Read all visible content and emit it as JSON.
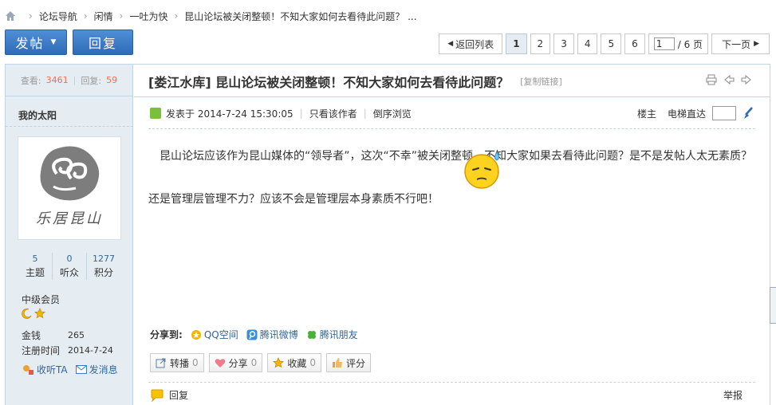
{
  "breadcrumb": {
    "items": [
      "论坛导航",
      "闲情",
      "一吐为快",
      "昆山论坛被关闭整顿！不知大家如何去看待此问题？ ..."
    ],
    "separator": "›"
  },
  "actions": {
    "post": "发帖",
    "reply": "回复"
  },
  "pager": {
    "back": "返回列表",
    "pages": [
      "1",
      "2",
      "3",
      "4",
      "5",
      "6"
    ],
    "current": "1",
    "jump_value": "1",
    "jump_total": "/ 6 页",
    "next": "下一页"
  },
  "sidebar": {
    "views_label": "查看:",
    "views": "3461",
    "sep": "|",
    "replies_label": "回复:",
    "replies": "59",
    "username": "我的太阳",
    "avatar_text": "乐居昆山",
    "counts": [
      {
        "value": "5",
        "label": "主题"
      },
      {
        "value": "0",
        "label": "听众"
      },
      {
        "value": "1277",
        "label": "积分"
      }
    ],
    "group": "中级会员",
    "info": [
      {
        "key": "金钱",
        "value": "265"
      },
      {
        "key": "注册时间",
        "value": "2014-7-24"
      }
    ],
    "follow": "收听TA",
    "message": "发消息"
  },
  "post": {
    "title": "[娄江水库] 昆山论坛被关闭整顿！不知大家如何去看待此问题？",
    "copy_link": "[复制链接]",
    "posted": "发表于 2014-7-24 15:30:05",
    "only_author": "只看该作者",
    "reverse": "倒序浏览",
    "floor": "楼主",
    "elevator": "电梯直达",
    "content": "昆山论坛应该作为昆山媒体的“领导者”，这次“不幸”被关闭整顿，不知大家如果去看待此问题？是不是发帖人太无素质？还是管理层管理不力？应该不会是管理层本身素质不行吧！",
    "share_label": "分享到:",
    "share_items": [
      "QQ空间",
      "腾讯微博",
      "腾讯朋友"
    ],
    "buttons": [
      {
        "label": "转播",
        "count": "0"
      },
      {
        "label": "分享",
        "count": "0"
      },
      {
        "label": "收藏",
        "count": "0"
      },
      {
        "label": "评分",
        "count": ""
      }
    ],
    "reply": "回复",
    "report": "举报"
  },
  "colors": {
    "accent": "#2f6bb8",
    "border": "#c2d5e3",
    "side_bg": "#e5edf2",
    "link": "#336699",
    "count_red": "#f26c4f"
  }
}
